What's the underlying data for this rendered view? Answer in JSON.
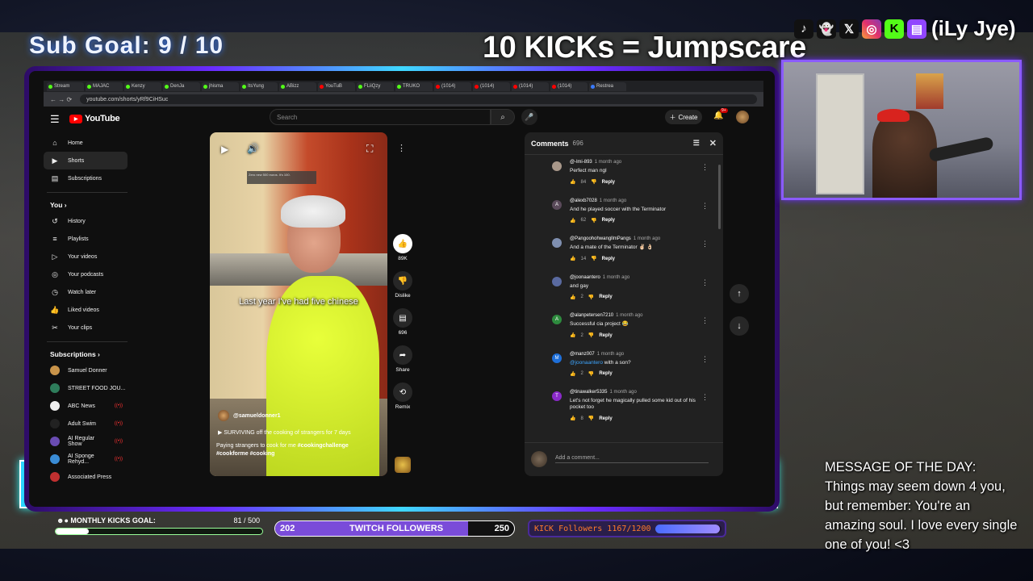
{
  "overlay": {
    "sub_goal": "Sub Goal:  9 / 10",
    "kicks_title": "10 KICKs = Jumpscare",
    "handle": "(iLy Jye)",
    "social_icons": [
      "tiktok-icon",
      "snapchat-icon",
      "x-icon",
      "instagram-icon",
      "kick-icon",
      "twitch-icon"
    ]
  },
  "browser": {
    "tabs": [
      "Stream",
      "MAJAC",
      "Kenzy",
      "DenJa",
      "jhisma",
      "ItsYung",
      "ABizz",
      "YouTuB",
      "FLiiQzy",
      "TRUKO",
      "(1014)",
      "(1014)",
      "(1014)",
      "(1014)",
      "Restrea"
    ],
    "url": "youtube.com/shorts/yRf9CiHSuc"
  },
  "youtube": {
    "logo_text": "YouTube",
    "search_placeholder": "Search",
    "create_label": "Create",
    "notif_count": "9+",
    "sidebar_main": [
      {
        "icon": "home-icon",
        "glyph": "⌂",
        "label": "Home"
      },
      {
        "icon": "shorts-icon",
        "glyph": "▶",
        "label": "Shorts"
      },
      {
        "icon": "subscriptions-icon",
        "glyph": "▤",
        "label": "Subscriptions"
      }
    ],
    "you_label": "You",
    "sidebar_you": [
      {
        "icon": "history-icon",
        "glyph": "↺",
        "label": "History"
      },
      {
        "icon": "playlists-icon",
        "glyph": "≡",
        "label": "Playlists"
      },
      {
        "icon": "your-videos-icon",
        "glyph": "▷",
        "label": "Your videos"
      },
      {
        "icon": "podcasts-icon",
        "glyph": "◎",
        "label": "Your podcasts"
      },
      {
        "icon": "watch-later-icon",
        "glyph": "◷",
        "label": "Watch later"
      },
      {
        "icon": "liked-icon",
        "glyph": "👍",
        "label": "Liked videos"
      },
      {
        "icon": "clips-icon",
        "glyph": "✂",
        "label": "Your clips"
      }
    ],
    "subscriptions_label": "Subscriptions",
    "subscriptions": [
      {
        "label": "Samuel Donner",
        "color": "#c9944a",
        "live": false
      },
      {
        "label": "STREET FOOD JOU...",
        "color": "#2e7d5b",
        "live": false
      },
      {
        "label": "ABC News",
        "color": "#eeeeee",
        "live": true
      },
      {
        "label": "Adult Swim",
        "color": "#222222",
        "live": true
      },
      {
        "label": "AI Regular Show",
        "color": "#6a4cb3",
        "live": true
      },
      {
        "label": "AI Sponge Rehyd...",
        "color": "#3a8cd6",
        "live": true
      },
      {
        "label": "Associated Press",
        "color": "#c03030",
        "live": false
      }
    ]
  },
  "short": {
    "caption": "Last year I've had five chinese",
    "sticker": "Zero new 500 euros. It's 100.",
    "channel": "@samueldonner1",
    "song": "SURVIVING off the cooking of strangers for 7 days",
    "desc_text": "Paying strangers to cook for me ",
    "tags": [
      "#cookingchallenge",
      "#cookforme",
      "#cooking"
    ],
    "actions": [
      {
        "name": "like",
        "glyph": "👍",
        "label": "89K"
      },
      {
        "name": "dislike",
        "glyph": "👎",
        "label": "Dislike"
      },
      {
        "name": "comments",
        "glyph": "▤",
        "label": "696"
      },
      {
        "name": "share",
        "glyph": "➦",
        "label": "Share"
      },
      {
        "name": "remix",
        "glyph": "⟲",
        "label": "Remix"
      }
    ]
  },
  "comments": {
    "title": "Comments",
    "count": "696",
    "add_placeholder": "Add a comment...",
    "reply_label": "Reply",
    "items": [
      {
        "user": "@-lmi-893",
        "ago": "1 month ago",
        "text": "Perfect man ngl",
        "likes": "84",
        "avatar_color": "#a9988a",
        "initial": ""
      },
      {
        "user": "@alexb7028",
        "ago": "1 month ago",
        "text": "And he played soccer with the Terminator",
        "likes": "62",
        "avatar_color": "#5a4a5a",
        "initial": "A"
      },
      {
        "user": "@PangoohohwangllmPangs",
        "ago": "1 month ago",
        "text": "And a mate of the Terminator ✌🏻 👌🏻",
        "likes": "14",
        "avatar_color": "#7f8fb0",
        "initial": ""
      },
      {
        "user": "@joonaantero",
        "ago": "1 month ago",
        "text": "and gay",
        "likes": "2",
        "avatar_color": "#5a6aa0",
        "initial": ""
      },
      {
        "user": "@alanpetersen7210",
        "ago": "1 month ago",
        "text": "Successful cia project 😂",
        "likes": "2",
        "avatar_color": "#2e8b3e",
        "initial": "A"
      },
      {
        "user": "@manz007",
        "ago": "1 month ago",
        "mention": "@joonaantero",
        "text": " with a son?",
        "likes": "2",
        "avatar_color": "#1e6fd9",
        "initial": "M"
      },
      {
        "user": "@tinawalker5335",
        "ago": "1 month ago",
        "text": "Let's not forget he magically pulled some kid out of his pocket too",
        "likes": "8",
        "avatar_color": "#8a2ac9",
        "initial": "T"
      }
    ]
  },
  "bottom": {
    "kicks_goal_label": "MONTHLY KICKS GOAL:",
    "kicks_goal_value": "81 / 500",
    "kicks_goal_fraction": 0.162,
    "twitch_current": "202",
    "twitch_label": "TWITCH FOLLOWERS",
    "twitch_target": "250",
    "twitch_fraction": 0.808,
    "kick_followers_label": "KICK Followers 1167/1200",
    "kick_fraction": 0.9725
  },
  "motd": {
    "title": "MESSAGE OF THE DAY:",
    "body": "Things may seem down 4 you, but remember: You're an amazing soul. I love every single one of you! <3"
  },
  "colors": {
    "frame_accent": "#6a2cff",
    "twitch": "#7a4cd9",
    "kick_orange": "#ff7a2a",
    "youtube_red": "#ff0000"
  }
}
